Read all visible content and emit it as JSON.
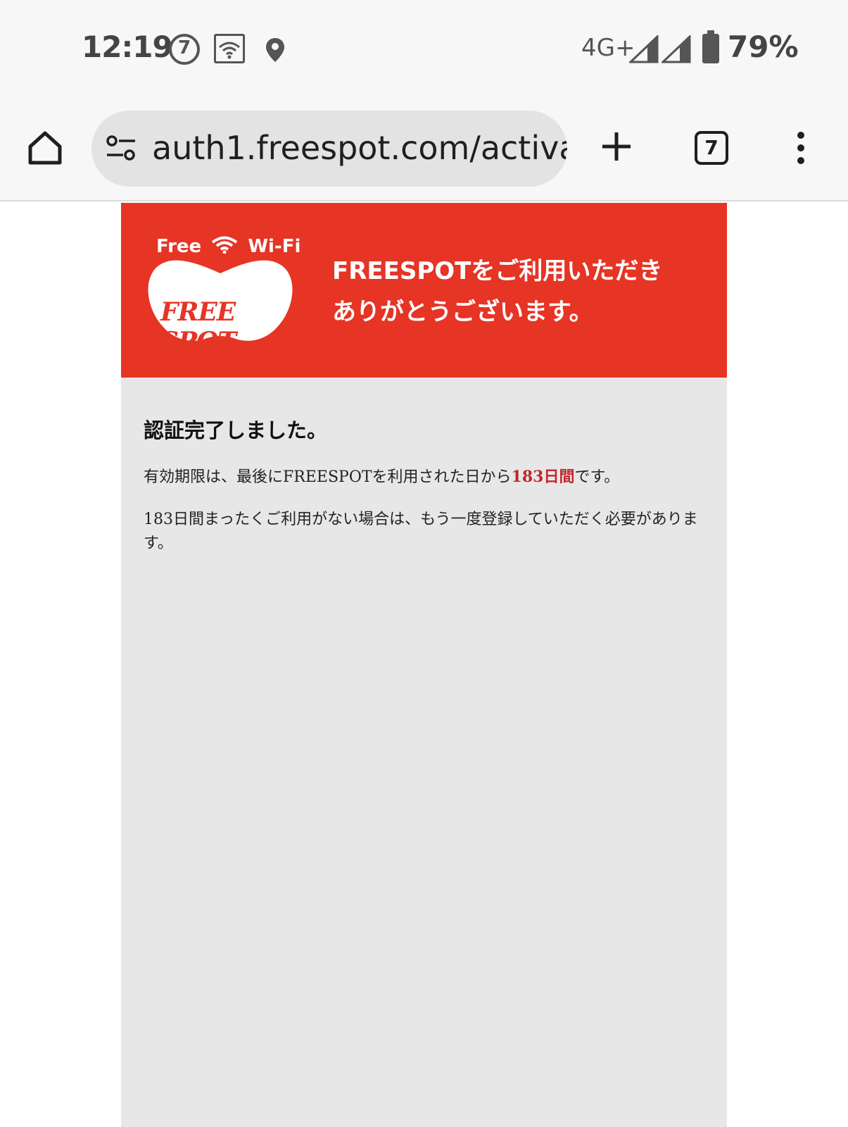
{
  "status_bar": {
    "time": "12:19",
    "network": "4G+",
    "battery": "79%",
    "icons": [
      "seven-eleven-icon",
      "au-wifi-icon",
      "location-icon",
      "signal-icon",
      "signal-icon",
      "battery-icon"
    ]
  },
  "browser": {
    "url": "auth1.freespot.com/activa",
    "tab_count": "7",
    "icons": [
      "home-icon",
      "site-settings-icon",
      "plus-icon",
      "menu-dots-icon"
    ]
  },
  "hero": {
    "logo_top_left": "Free",
    "logo_top_right": "Wi-Fi",
    "logo_word": "FREE SPOT",
    "message_line1": "FREESPOTをご利用いただき",
    "message_line2": "ありがとうございます。"
  },
  "content": {
    "heading": "認証完了しました。",
    "para1_prefix": "有効期限は、最後にFREESPOTを利用された日から",
    "para1_highlight": "183日間",
    "para1_suffix": "です。",
    "para2": "183日間まったくご利用がない場合は、もう一度登録していただく必要があります。"
  },
  "colors": {
    "brand_red": "#e63425",
    "highlight_red": "#c0272d",
    "page_bg": "#e7e7e7",
    "chrome_bg": "#f7f7f7"
  }
}
